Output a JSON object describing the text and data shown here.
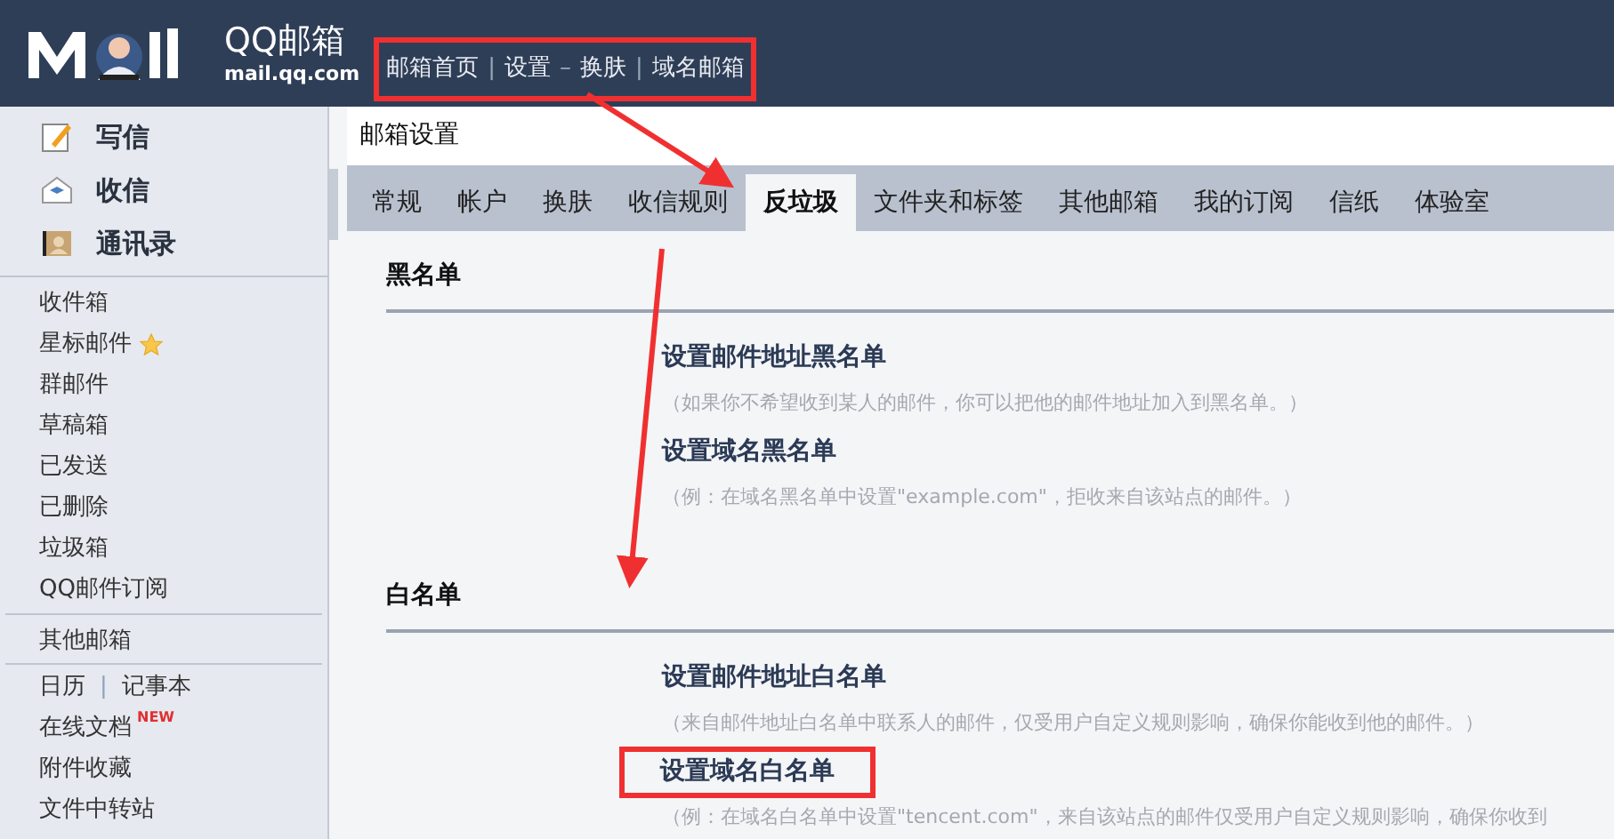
{
  "header": {
    "logo_text": "QQ邮箱",
    "logo_url": "mail.qq.com",
    "links": [
      "邮箱首页",
      "设置",
      "换肤",
      "域名邮箱"
    ],
    "separators": [
      "|",
      "–",
      "|"
    ]
  },
  "sidebar": {
    "actions": [
      {
        "kind": "compose",
        "label": "写信"
      },
      {
        "kind": "inbox",
        "label": "收信"
      },
      {
        "kind": "contacts",
        "label": "通讯录"
      }
    ],
    "folders": [
      {
        "label": "收件箱",
        "starred": false
      },
      {
        "label": "星标邮件",
        "starred": true
      },
      {
        "label": "群邮件",
        "starred": false
      },
      {
        "label": "草稿箱",
        "starred": false
      },
      {
        "label": "已发送",
        "starred": false
      },
      {
        "label": "已删除",
        "starred": false
      },
      {
        "label": "垃圾箱",
        "starred": false
      },
      {
        "label": "QQ邮件订阅",
        "starred": false
      }
    ],
    "other": "其他邮箱",
    "tools": [
      "日历",
      "记事本"
    ],
    "tools_separator": "|",
    "extras": [
      {
        "label": "在线文档",
        "badge": "NEW"
      },
      {
        "label": "附件收藏"
      },
      {
        "label": "文件中转站"
      }
    ]
  },
  "page_title": "邮箱设置",
  "tabs": [
    {
      "label": "常规",
      "selected": false
    },
    {
      "label": "帐户",
      "selected": false
    },
    {
      "label": "换肤",
      "selected": false
    },
    {
      "label": "收信规则",
      "selected": false
    },
    {
      "label": "反垃圾",
      "selected": true
    },
    {
      "label": "文件夹和标签",
      "selected": false
    },
    {
      "label": "其他邮箱",
      "selected": false
    },
    {
      "label": "我的订阅",
      "selected": false
    },
    {
      "label": "信纸",
      "selected": false
    },
    {
      "label": "体验室",
      "selected": false
    }
  ],
  "sections": [
    {
      "title": "黑名单",
      "items": [
        {
          "link": "设置邮件地址黑名单",
          "note": "（如果你不希望收到某人的邮件，你可以把他的邮件地址加入到黑名单。）",
          "highlighted": false
        },
        {
          "link": "设置域名黑名单",
          "note": "（例：在域名黑名单中设置\"example.com\"，拒收来自该站点的邮件。）",
          "highlighted": false
        }
      ]
    },
    {
      "title": "白名单",
      "items": [
        {
          "link": "设置邮件地址白名单",
          "note": "（来自邮件地址白名单中联系人的邮件，仅受用户自定义规则影响，确保你能收到他的邮件。）",
          "highlighted": false
        },
        {
          "link": "设置域名白名单",
          "note": "（例：在域名白名单中设置\"tencent.com\"，来自该站点的邮件仅受用户自定义规则影响，确保你收到",
          "highlighted": true
        }
      ]
    }
  ]
}
